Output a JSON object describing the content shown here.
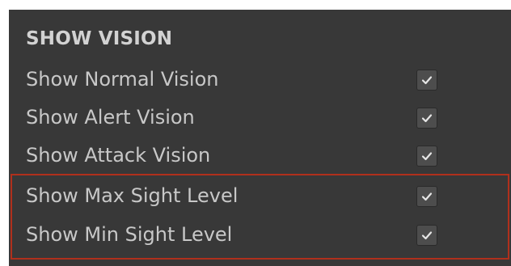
{
  "section": {
    "title": "SHOW VISION"
  },
  "rows": [
    {
      "label": "Show Normal Vision",
      "checked": true
    },
    {
      "label": "Show Alert Vision",
      "checked": true
    },
    {
      "label": "Show Attack Vision",
      "checked": true
    },
    {
      "label": "Show Max Sight Level",
      "checked": true
    },
    {
      "label": "Show Min Sight Level",
      "checked": true
    }
  ],
  "colors": {
    "panel_background": "#383838",
    "text": "#c8c8c8",
    "checkbox_background": "#4d4d4d",
    "checkmark": "#e6e6e6",
    "highlight_border": "#b0301c"
  },
  "icons": {
    "checkbox": "checkmark-icon"
  }
}
